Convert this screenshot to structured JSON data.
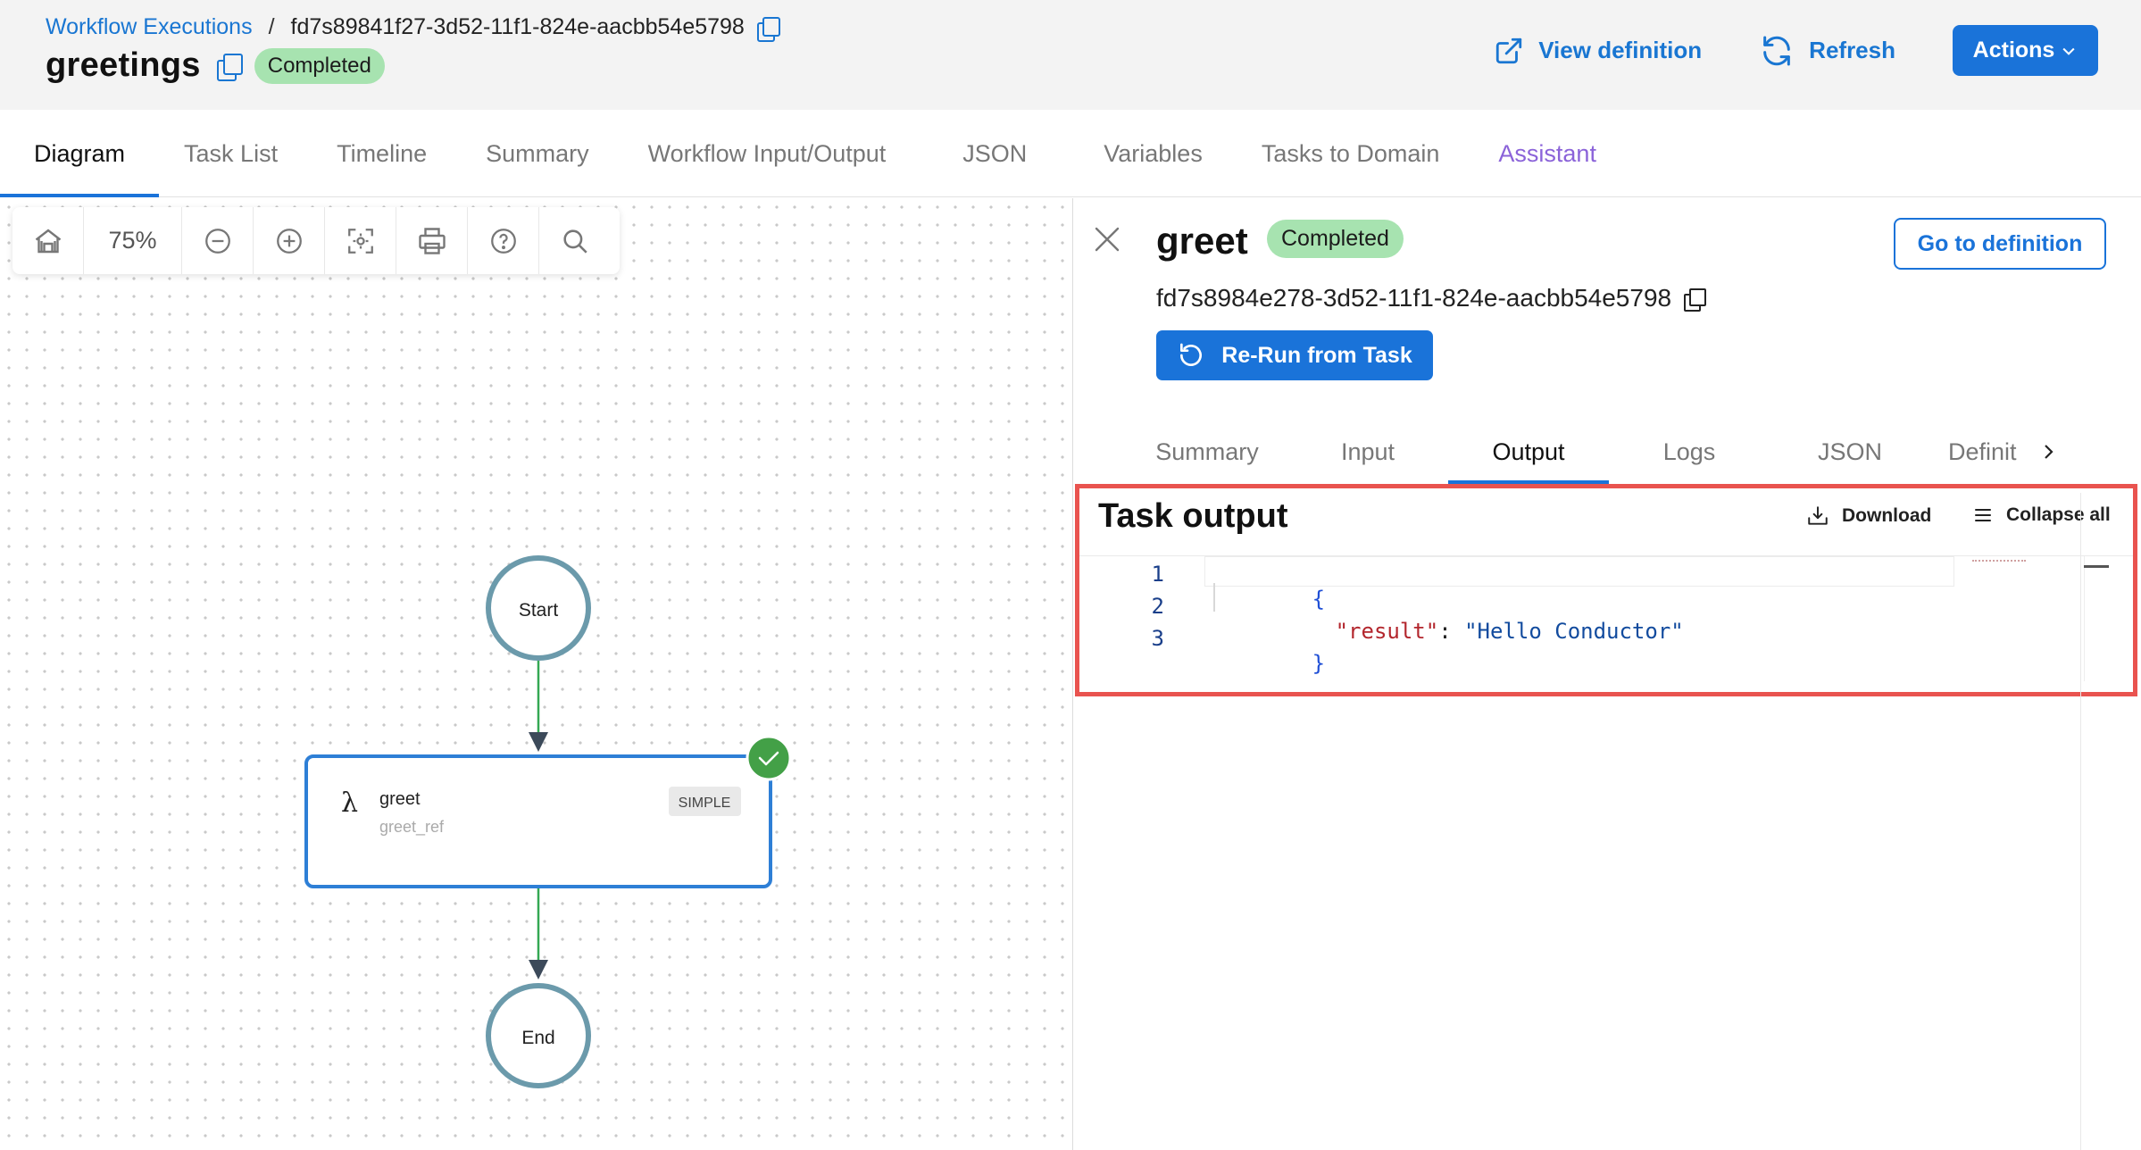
{
  "breadcrumb": {
    "root": "Workflow Executions",
    "separator": "/",
    "execution_id": "fd7s89841f27-3d52-11f1-824e-aacbb54e5798"
  },
  "workflow": {
    "name": "greetings",
    "status": "Completed"
  },
  "header_actions": {
    "view_definition": "View definition",
    "refresh": "Refresh",
    "actions": "Actions"
  },
  "main_tabs": [
    {
      "label": "Diagram",
      "active": true
    },
    {
      "label": "Task List",
      "active": false
    },
    {
      "label": "Timeline",
      "active": false
    },
    {
      "label": "Summary",
      "active": false
    },
    {
      "label": "Workflow Input/Output",
      "active": false
    },
    {
      "label": "JSON",
      "active": false
    },
    {
      "label": "Variables",
      "active": false
    },
    {
      "label": "Tasks to Domain",
      "active": false
    },
    {
      "label": "Assistant",
      "active": false
    }
  ],
  "diagram": {
    "zoom": "75%",
    "tools": [
      "home-icon",
      "zoom-out-icon",
      "zoom-in-icon",
      "fit-screen-icon",
      "print-icon",
      "help-icon",
      "search-icon"
    ],
    "start_label": "Start",
    "end_label": "End",
    "task": {
      "glyph": "λ",
      "name": "greet",
      "ref": "greet_ref",
      "type": "SIMPLE",
      "status": "completed"
    }
  },
  "panel": {
    "task_name": "greet",
    "status": "Completed",
    "task_id": "fd7s8984e278-3d52-11f1-824e-aacbb54e5798",
    "go_to_definition": "Go to definition",
    "rerun": "Re-Run from Task",
    "tabs": [
      {
        "label": "Summary",
        "active": false
      },
      {
        "label": "Input",
        "active": false
      },
      {
        "label": "Output",
        "active": true
      },
      {
        "label": "Logs",
        "active": false
      },
      {
        "label": "JSON",
        "active": false
      },
      {
        "label": "Definit",
        "active": false
      }
    ],
    "output": {
      "title": "Task output",
      "download": "Download",
      "collapse_all": "Collapse all",
      "line_numbers": [
        "1",
        "2",
        "3"
      ],
      "open_brace": "{",
      "key": "\"result\"",
      "colon": ": ",
      "value": "\"Hello Conductor\"",
      "close_brace": "}"
    }
  },
  "colors": {
    "accent": "#1a73d9",
    "completed_badge": "#a7e3b0",
    "success": "#34a853",
    "node_ring": "#6b9aab",
    "highlight_border": "#e9534f",
    "assistant_tab": "#8b63d9"
  }
}
